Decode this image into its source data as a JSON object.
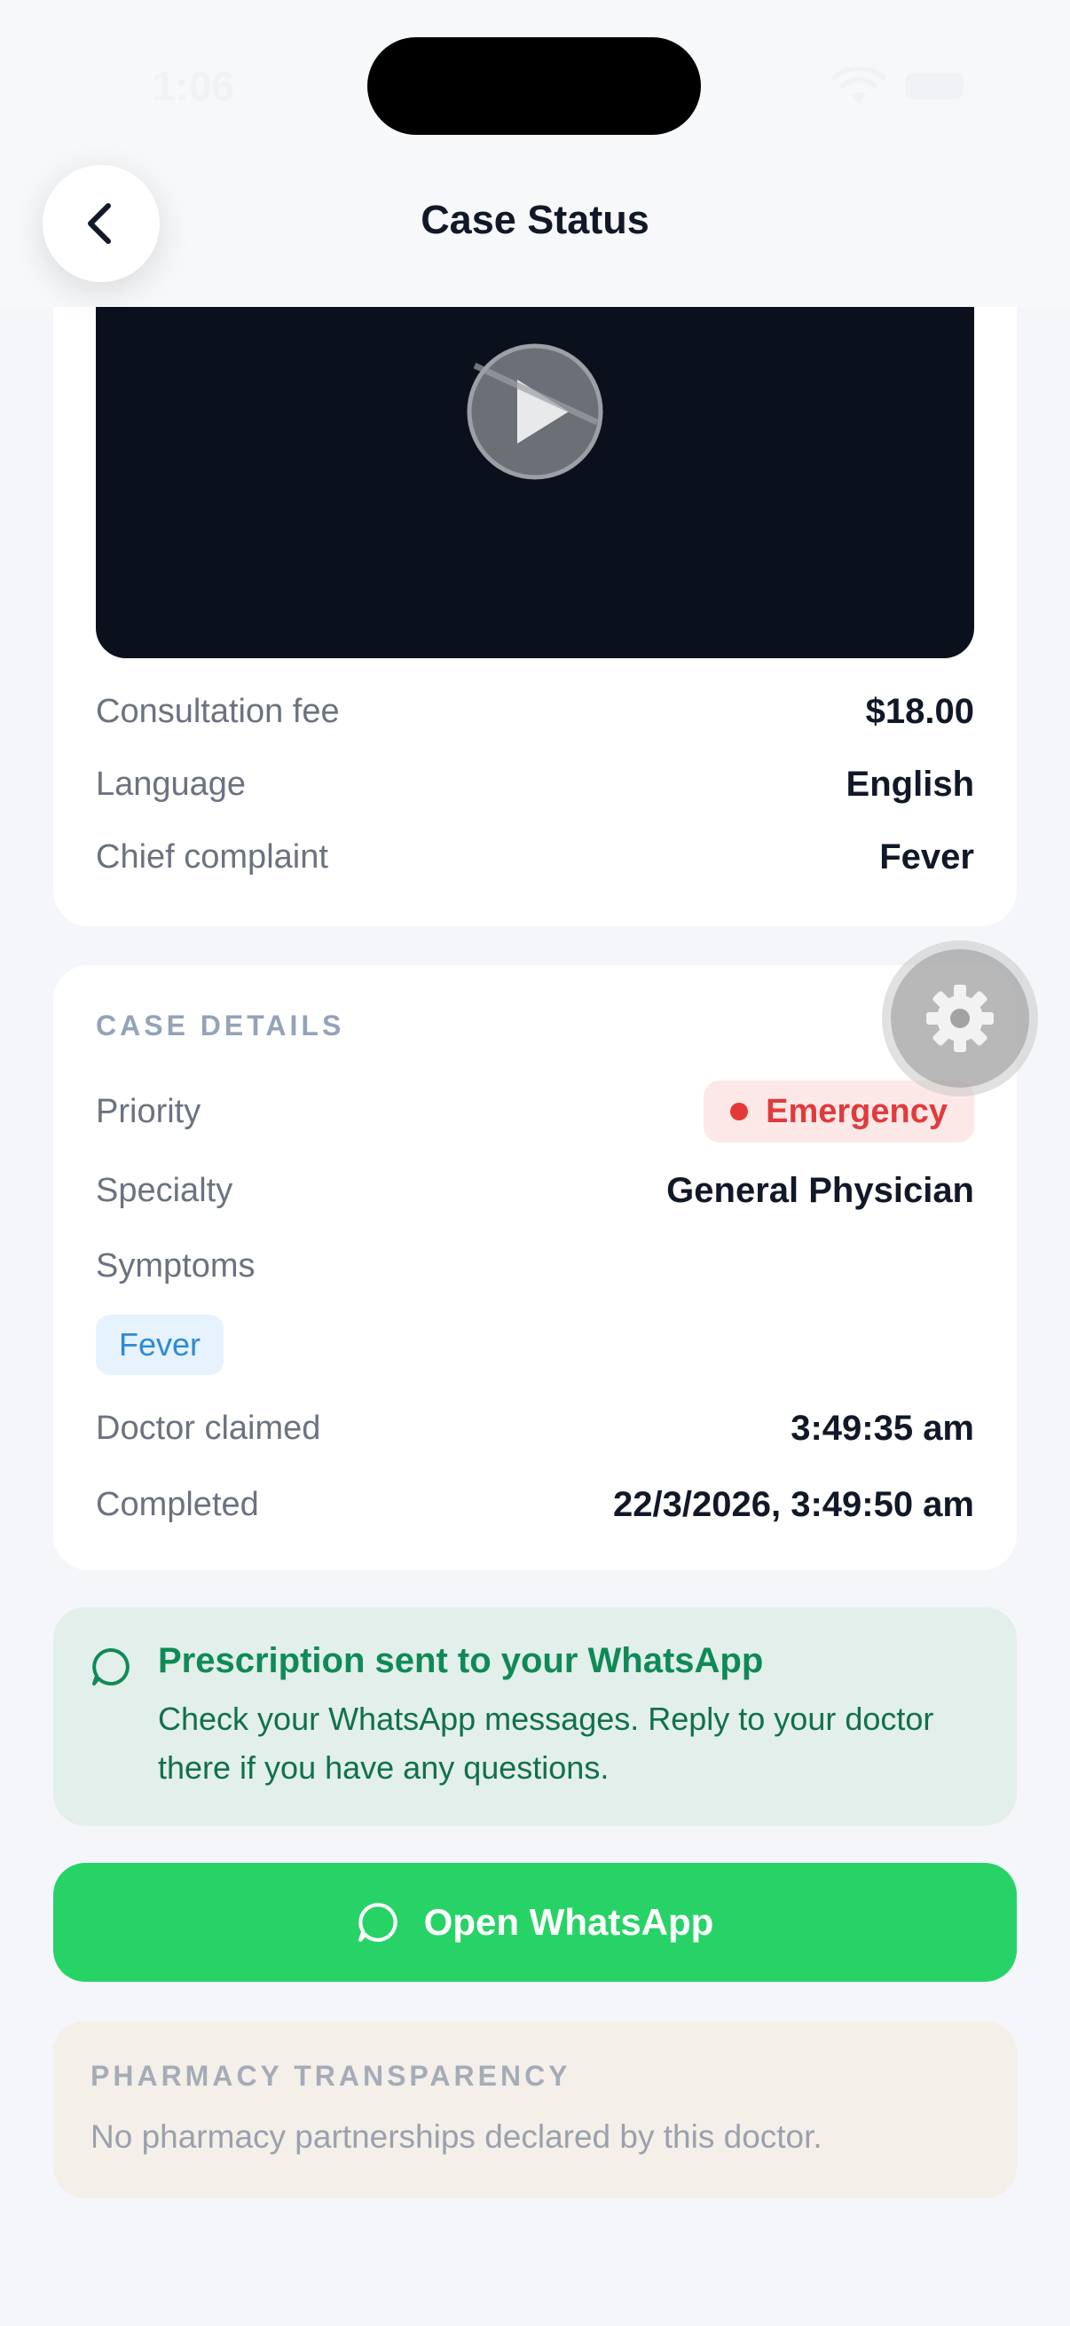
{
  "status_bar": {
    "time": "1:06"
  },
  "header": {
    "title": "Case Status"
  },
  "consultation": {
    "rows": [
      {
        "label": "Consultation fee",
        "value": "$18.00"
      },
      {
        "label": "Language",
        "value": "English"
      },
      {
        "label": "Chief complaint",
        "value": "Fever"
      }
    ]
  },
  "case_details": {
    "title": "CASE DETAILS",
    "priority_label": "Priority",
    "priority_value": "Emergency",
    "specialty_label": "Specialty",
    "specialty_value": "General Physician",
    "symptoms_label": "Symptoms",
    "symptoms": [
      "Fever"
    ],
    "doctor_claimed_label": "Doctor claimed",
    "doctor_claimed_value": "3:49:35 am",
    "completed_label": "Completed",
    "completed_value": "22/3/2026, 3:49:50 am"
  },
  "prescription_notice": {
    "title": "Prescription sent to your WhatsApp",
    "text": "Check your WhatsApp messages. Reply to your doctor there if you have any questions."
  },
  "whatsapp_button": {
    "label": "Open WhatsApp"
  },
  "pharmacy": {
    "title": "PHARMACY TRANSPARENCY",
    "text": "No pharmacy partnerships declared by this doctor."
  },
  "icons": {
    "back": "chevron-left-icon",
    "play": "play-icon",
    "gear": "gear-icon",
    "chat": "chat-bubble-icon",
    "wifi": "wifi-icon",
    "battery": "battery-icon"
  },
  "colors": {
    "emergency": "#e03b3b",
    "whatsapp_green": "#27d366",
    "notice_bg": "#e2efeb",
    "symptom_chip": "#2d8ad8"
  }
}
